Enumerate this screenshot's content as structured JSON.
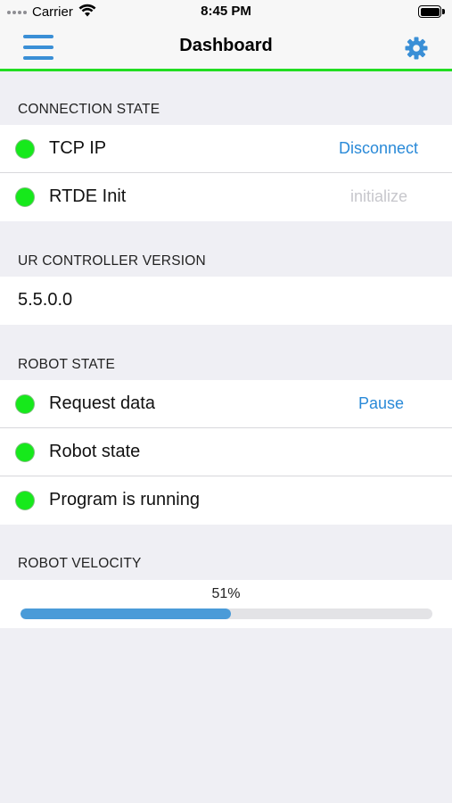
{
  "status_bar": {
    "carrier": "Carrier",
    "time": "8:45 PM"
  },
  "nav": {
    "title": "Dashboard",
    "menu_icon": "hamburger-menu-icon",
    "settings_icon": "gear-icon",
    "accent_color": "#3a8fd6",
    "underline_color": "#22dd22"
  },
  "connection": {
    "header": "CONNECTION STATE",
    "tcp_label": "TCP IP",
    "tcp_action": "Disconnect",
    "rtde_label": "RTDE Init",
    "rtde_action": "initialize"
  },
  "controller": {
    "header": "UR CONTROLLER VERSION",
    "version": "5.5.0.0"
  },
  "robot_state": {
    "header": "ROBOT STATE",
    "request_label": "Request data",
    "request_action": "Pause",
    "state_label": "Robot state",
    "program_label": "Program is running"
  },
  "velocity": {
    "header": "ROBOT VELOCITY",
    "percent_label": "51%",
    "fraction": 0.51
  },
  "status_colors": {
    "ok": "#16e91b",
    "action": "#2a8ad8",
    "disabled": "#c7c7cc"
  }
}
